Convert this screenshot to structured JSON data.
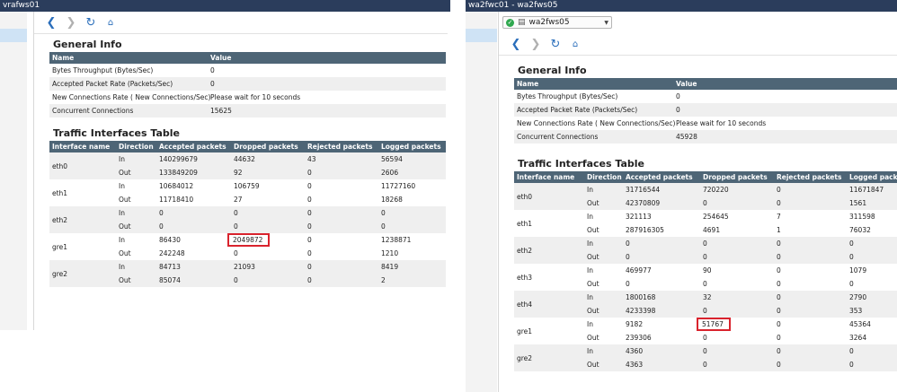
{
  "left": {
    "title": "vrafws01",
    "general_info": {
      "title": "General Info",
      "headers": [
        "Name",
        "Value"
      ],
      "rows": [
        [
          "Bytes Throughput (Bytes/Sec)",
          "0"
        ],
        [
          "Accepted Packet Rate (Packets/Sec)",
          "0"
        ],
        [
          "New Connections Rate ( New Connections/Sec)",
          "Please wait for 10 seconds"
        ],
        [
          "Concurrent Connections",
          "15625"
        ]
      ]
    },
    "traffic": {
      "title": "Traffic Interfaces Table",
      "headers": [
        "Interface name",
        "Direction",
        "Accepted packets",
        "Dropped packets",
        "Rejected packets",
        "Logged packets"
      ],
      "interfaces": [
        {
          "name": "eth0",
          "rows": [
            [
              "In",
              "140299679",
              "44632",
              "43",
              "56594"
            ],
            [
              "Out",
              "133849209",
              "92",
              "0",
              "2606"
            ]
          ]
        },
        {
          "name": "eth1",
          "rows": [
            [
              "In",
              "10684012",
              "106759",
              "0",
              "11727160"
            ],
            [
              "Out",
              "11718410",
              "27",
              "0",
              "18268"
            ]
          ]
        },
        {
          "name": "eth2",
          "rows": [
            [
              "In",
              "0",
              "0",
              "0",
              "0"
            ],
            [
              "Out",
              "0",
              "0",
              "0",
              "0"
            ]
          ]
        },
        {
          "name": "gre1",
          "rows": [
            [
              "In",
              "86430",
              "2049872",
              "0",
              "1238871"
            ],
            [
              "Out",
              "242248",
              "0",
              "0",
              "1210"
            ]
          ]
        },
        {
          "name": "gre2",
          "rows": [
            [
              "In",
              "84713",
              "21093",
              "0",
              "8419"
            ],
            [
              "Out",
              "85074",
              "0",
              "0",
              "2"
            ]
          ]
        }
      ]
    }
  },
  "right": {
    "title": "wa2fwc01 - wa2fws05",
    "device_select": {
      "value": "wa2fws05"
    },
    "general_info": {
      "title": "General Info",
      "headers": [
        "Name",
        "Value"
      ],
      "rows": [
        [
          "Bytes Throughput (Bytes/Sec)",
          "0"
        ],
        [
          "Accepted Packet Rate (Packets/Sec)",
          "0"
        ],
        [
          "New Connections Rate ( New Connections/Sec)",
          "Please wait for 10 seconds"
        ],
        [
          "Concurrent Connections",
          "45928"
        ]
      ]
    },
    "traffic": {
      "title": "Traffic Interfaces Table",
      "headers": [
        "Interface name",
        "Direction",
        "Accepted packets",
        "Dropped packets",
        "Rejected packets",
        "Logged packets"
      ],
      "interfaces": [
        {
          "name": "eth0",
          "rows": [
            [
              "In",
              "31716544",
              "720220",
              "0",
              "11671847"
            ],
            [
              "Out",
              "42370809",
              "0",
              "0",
              "1561"
            ]
          ]
        },
        {
          "name": "eth1",
          "rows": [
            [
              "In",
              "321113",
              "254645",
              "7",
              "311598"
            ],
            [
              "Out",
              "287916305",
              "4691",
              "1",
              "76032"
            ]
          ]
        },
        {
          "name": "eth2",
          "rows": [
            [
              "In",
              "0",
              "0",
              "0",
              "0"
            ],
            [
              "Out",
              "0",
              "0",
              "0",
              "0"
            ]
          ]
        },
        {
          "name": "eth3",
          "rows": [
            [
              "In",
              "469977",
              "90",
              "0",
              "1079"
            ],
            [
              "Out",
              "0",
              "0",
              "0",
              "0"
            ]
          ]
        },
        {
          "name": "eth4",
          "rows": [
            [
              "In",
              "1800168",
              "32",
              "0",
              "2790"
            ],
            [
              "Out",
              "4233398",
              "0",
              "0",
              "353"
            ]
          ]
        },
        {
          "name": "gre1",
          "rows": [
            [
              "In",
              "9182",
              "51767",
              "0",
              "45364"
            ],
            [
              "Out",
              "239306",
              "0",
              "0",
              "3264"
            ]
          ]
        },
        {
          "name": "gre2",
          "rows": [
            [
              "In",
              "4360",
              "0",
              "0",
              "0"
            ],
            [
              "Out",
              "4363",
              "0",
              "0",
              "0"
            ]
          ]
        }
      ]
    }
  },
  "icons": {
    "back": "chevron-left-icon",
    "forward": "chevron-right-icon",
    "refresh": "refresh-icon",
    "home": "home-icon",
    "status": "check-circle-icon"
  },
  "colors": {
    "titlebar": "#2b3d5c",
    "table_header": "#4e6576",
    "highlight_box": "#d9232d",
    "status_ok": "#2fa84f"
  }
}
